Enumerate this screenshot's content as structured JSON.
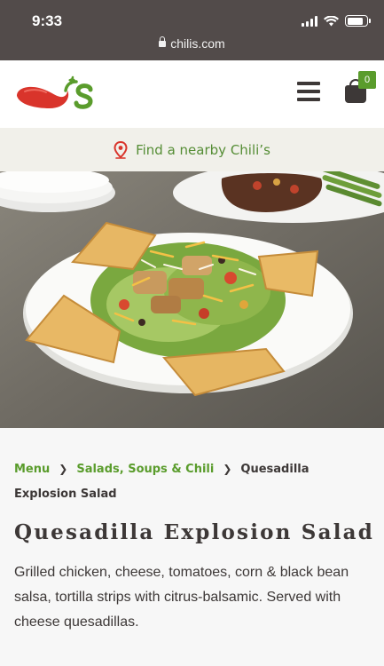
{
  "status_bar": {
    "time": "9:33",
    "url": "chilis.com"
  },
  "header": {
    "logo_alt": "Chili's",
    "cart_count": "0",
    "accent_green": "#5a9c2c",
    "brand_red": "#d9342b"
  },
  "find_nearby": {
    "label": "Find a nearby Chili’s",
    "icon": "map-pin-icon"
  },
  "hero_image": {
    "alt": "Quesadilla Explosion Salad"
  },
  "breadcrumb": {
    "items": [
      "Menu",
      "Salads, Soups & Chili"
    ],
    "current": "Quesadilla Explosion Salad"
  },
  "item": {
    "title": "Quesadilla Explosion Salad",
    "description": "Grilled chicken, cheese, tomatoes, corn & black bean salsa, tortilla strips with citrus-balsamic. Served with cheese quesadillas."
  }
}
